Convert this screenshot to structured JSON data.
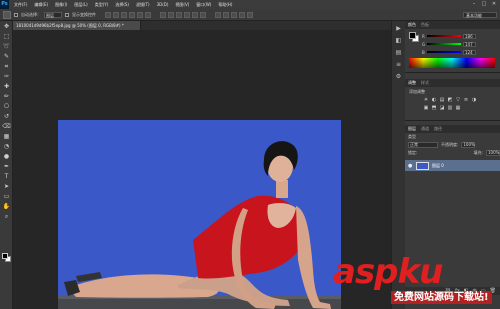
{
  "app": {
    "logo": "Ps"
  },
  "menubar": {
    "items": [
      "文件(F)",
      "编辑(E)",
      "图像(I)",
      "图层(L)",
      "类型(Y)",
      "选择(S)",
      "滤镜(T)",
      "3D(D)",
      "视图(V)",
      "窗口(W)",
      "帮助(H)"
    ],
    "minimize": "–",
    "restore": "□",
    "close": "✕"
  },
  "options": {
    "auto_select_label": "自动选择：",
    "auto_select_value": "图层",
    "show_transform_label": "显示变换控件",
    "workspace": "基本功能"
  },
  "document": {
    "tab_title": "1810041d9d96b2f5ep8.jpg @ 50% (图层 0, RGB/8#) *"
  },
  "toolbar": {
    "tools": [
      "move-tool",
      "marquee-tool",
      "lasso-tool",
      "quick-select-tool",
      "crop-tool",
      "eyedropper-tool",
      "healing-tool",
      "brush-tool",
      "clone-tool",
      "history-brush-tool",
      "eraser-tool",
      "gradient-tool",
      "blur-tool",
      "dodge-tool",
      "pen-tool",
      "type-tool",
      "path-select-tool",
      "shape-tool",
      "hand-tool",
      "zoom-tool"
    ],
    "glyphs": [
      "✥",
      "⬚",
      "➰",
      "✎",
      "⌗",
      "✑",
      "✚",
      "✏",
      "⎔",
      "↺",
      "⌫",
      "▦",
      "◔",
      "●",
      "✒",
      "T",
      "➤",
      "▭",
      "✋",
      "⌕"
    ],
    "fg_color": "#000000",
    "bg_color": "#ffffff"
  },
  "color_panel": {
    "tabs": [
      "颜色",
      "色板"
    ],
    "sliders": [
      {
        "letter": "R",
        "value": "186",
        "color": "#e05050"
      },
      {
        "letter": "G",
        "value": "147",
        "color": "#50c050"
      },
      {
        "letter": "B",
        "value": "124",
        "color": "#5070e0"
      }
    ]
  },
  "adjust_panel": {
    "tabs": [
      "调整",
      "样式"
    ],
    "label": "添加调整",
    "icons": [
      "☀",
      "◐",
      "▤",
      "◩",
      "▽",
      "≡",
      "◑",
      "▣",
      "⬒",
      "◪",
      "▥",
      "▦"
    ]
  },
  "layers_panel": {
    "tabs": [
      "图层",
      "通道",
      "路径"
    ],
    "kind_label": "类型",
    "mode": "正常",
    "opacity_label": "不透明度:",
    "opacity_value": "100%",
    "lock_label": "锁定:",
    "fill_label": "填充:",
    "fill_value": "100%",
    "layer_name": "图层 0",
    "footer_icons": [
      "⛓",
      "fx",
      "◧",
      "◍",
      "▭",
      "🗑"
    ]
  },
  "dock": {
    "icons": [
      "▶",
      "◧",
      "▤",
      "≡",
      "⚙"
    ]
  },
  "watermark": {
    "text": "aspku",
    "sub": "免费网站源码下载站!"
  }
}
